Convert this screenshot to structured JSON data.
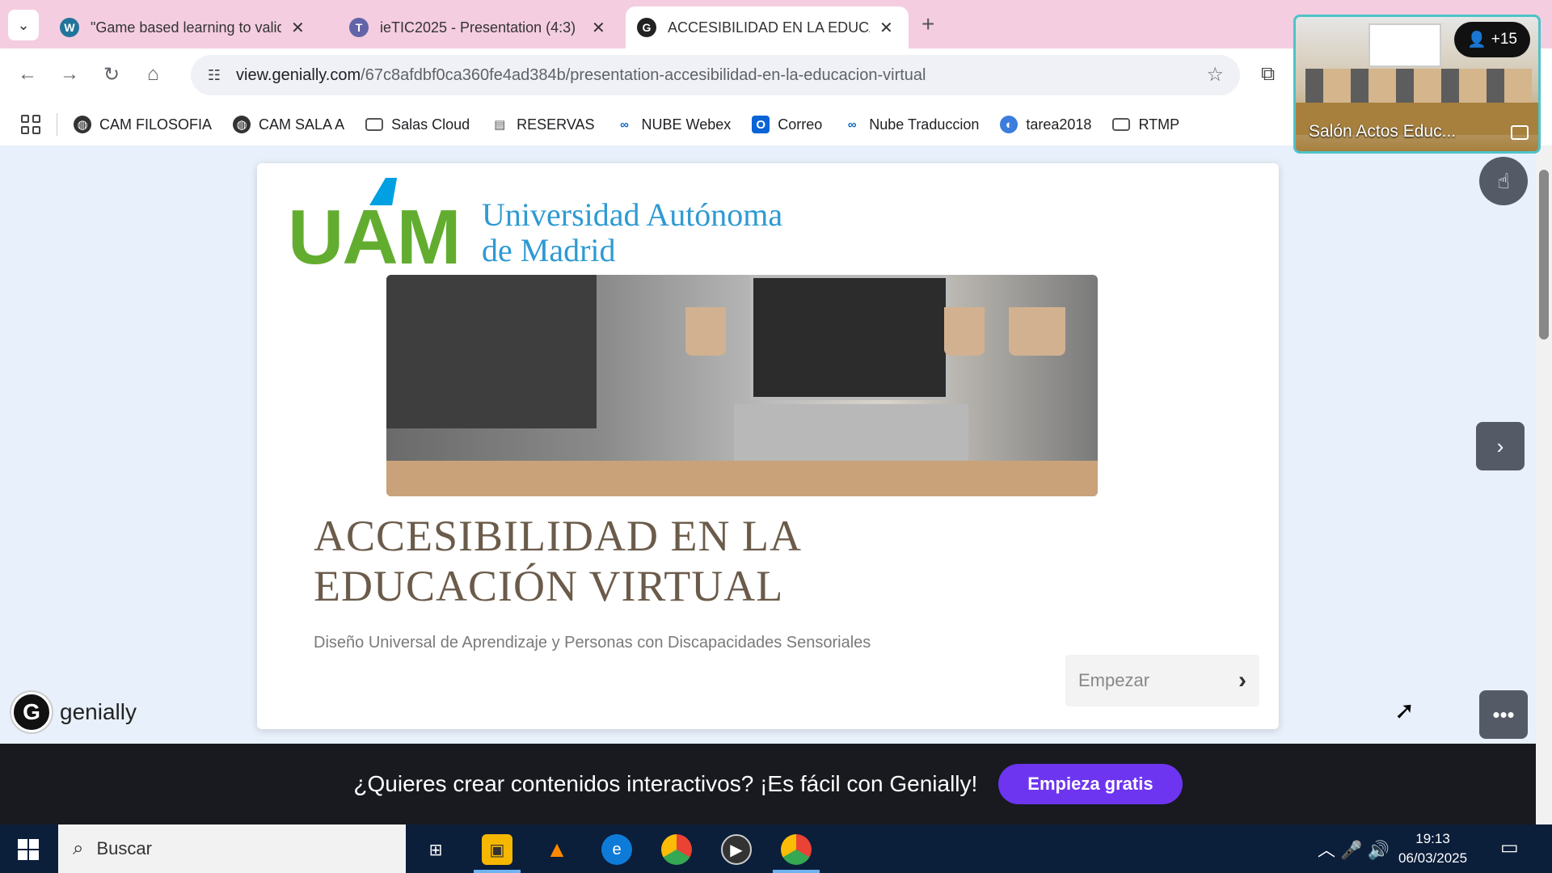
{
  "browser": {
    "tabs": [
      {
        "title": "\"Game based learning to valida",
        "icon": "wordpress-icon",
        "active": false
      },
      {
        "title": "ieTIC2025 - Presentation (4:3)",
        "icon": "teams-icon",
        "active": false
      },
      {
        "title": "ACCESIBILIDAD EN LA EDUCAC",
        "icon": "genially-icon",
        "active": true
      }
    ],
    "url_host": "view.genially.com",
    "url_path": "/67c8afdbf0ca360fe4ad384b/presentation-accesibilidad-en-la-educacion-virtual",
    "bookmarks": [
      {
        "label": "CAM FILOSOFIA",
        "icon": "globe-icon"
      },
      {
        "label": "CAM SALA A",
        "icon": "globe-icon"
      },
      {
        "label": "Salas Cloud",
        "icon": "folder-icon"
      },
      {
        "label": "RESERVAS",
        "icon": "reserve-icon"
      },
      {
        "label": "NUBE Webex",
        "icon": "webex-icon"
      },
      {
        "label": "Correo",
        "icon": "outlook-icon"
      },
      {
        "label": "Nube Traduccion",
        "icon": "webex-icon"
      },
      {
        "label": "tarea2018",
        "icon": "app-icon"
      },
      {
        "label": "RTMP",
        "icon": "folder-icon"
      }
    ]
  },
  "slide": {
    "logo_text": "UAM",
    "university_line1": "Universidad Autónoma",
    "university_line2": "de Madrid",
    "title_line1": "ACCESIBILIDAD EN LA",
    "title_line2": "EDUCACIÓN VIRTUAL",
    "subtitle": "Diseño Universal de Aprendizaje y Personas con Discapacidades Sensoriales",
    "start_label": "Empezar"
  },
  "genially": {
    "brand": "genially",
    "banner_text": "¿Quieres crear contenidos interactivos? ¡Es fácil con Genially!",
    "banner_cta": "Empieza gratis"
  },
  "video_call": {
    "room": "Salón Actos Educ...",
    "participants": "+15"
  },
  "taskbar": {
    "search_placeholder": "Buscar",
    "time": "19:13",
    "date": "06/03/2025"
  },
  "colors": {
    "tabbar": "#f4cde0",
    "uam_green": "#62ad2f",
    "uam_blue": "#2e9ad3",
    "cta_purple": "#6d35f0",
    "taskbar": "#0b1e3a"
  }
}
